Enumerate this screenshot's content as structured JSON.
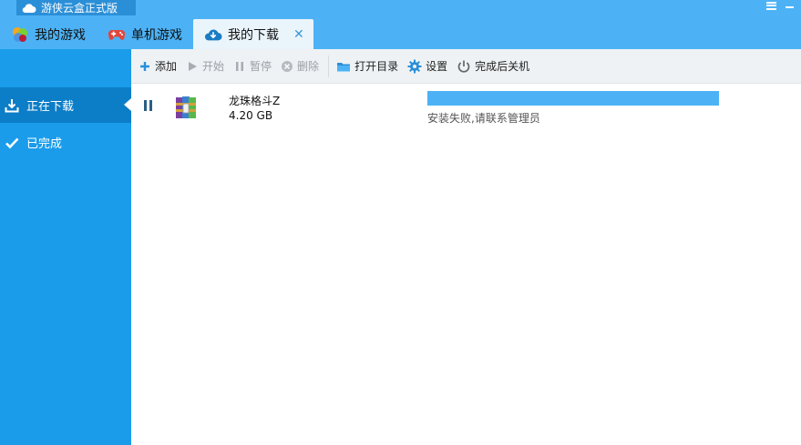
{
  "app": {
    "badge_title": "游侠云盒正式版"
  },
  "tabs": [
    {
      "label": "我的游戏",
      "icon": "colorful-balls-icon"
    },
    {
      "label": "单机游戏",
      "icon": "gamepad-icon"
    },
    {
      "label": "我的下载",
      "icon": "cloud-download-icon",
      "close": "✕"
    }
  ],
  "sidebar": {
    "items": [
      {
        "label": "正在下载",
        "icon": "download-icon"
      },
      {
        "label": "已完成",
        "icon": "check-icon"
      }
    ]
  },
  "toolbar": {
    "add": "添加",
    "start": "开始",
    "pause": "暂停",
    "delete": "删除",
    "open_dir": "打开目录",
    "settings": "设置",
    "shutdown_after": "完成后关机"
  },
  "downloads": [
    {
      "name": "龙珠格斗Z",
      "size": "4.20 GB",
      "progress": 1.0,
      "status": "安装失败,请联系管理员"
    }
  ],
  "colors": {
    "accent": "#4cb2f5",
    "sidebar": "#1a9cea",
    "sidebar_active": "#0c7dc7"
  }
}
